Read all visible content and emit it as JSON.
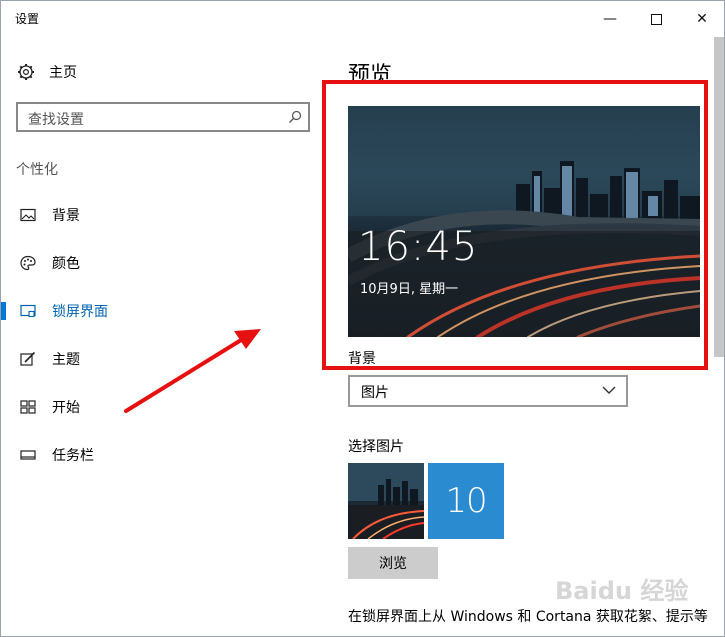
{
  "window": {
    "title": "设置",
    "minimize": "—",
    "close": "✕"
  },
  "sidebar": {
    "home_label": "主页",
    "search_placeholder": "查找设置",
    "section_label": "个性化",
    "items": [
      {
        "label": "背景",
        "icon": "image-icon"
      },
      {
        "label": "颜色",
        "icon": "palette-icon"
      },
      {
        "label": "锁屏界面",
        "icon": "lock-screen-icon",
        "active": true
      },
      {
        "label": "主题",
        "icon": "theme-icon"
      },
      {
        "label": "开始",
        "icon": "start-icon"
      },
      {
        "label": "任务栏",
        "icon": "taskbar-icon"
      }
    ]
  },
  "main": {
    "preview_title": "预览",
    "preview_time": "16:45",
    "preview_date": "10月9日, 星期一",
    "background_label": "背景",
    "background_value": "图片",
    "choose_label": "选择图片",
    "thumb2_text": "10",
    "browse_label": "浏览",
    "bottom_text": "在锁屏界面上从 Windows 和 Cortana 获取花絮、提示等"
  },
  "watermark": "Baidu 经验",
  "colors": {
    "accent": "#0078d7",
    "annotation_red": "#e61010"
  }
}
